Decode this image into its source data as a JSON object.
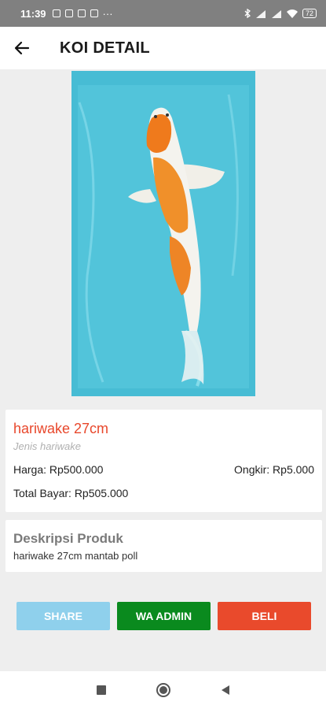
{
  "status_bar": {
    "time": "11:39",
    "more": "···",
    "battery": "72"
  },
  "app_bar": {
    "title": "KOI DETAIL"
  },
  "product": {
    "name": "hariwake 27cm",
    "type": "Jenis hariwake",
    "price": "Harga: Rp500.000",
    "shipping": "Ongkir: Rp5.000",
    "total": "Total Bayar: Rp505.000"
  },
  "description": {
    "title": "Deskripsi Produk",
    "text": "hariwake 27cm mantab poll"
  },
  "buttons": {
    "share": "SHARE",
    "wa_admin": "WA ADMIN",
    "beli": "BELI"
  },
  "colors": {
    "accent_red": "#e8472b",
    "share_blue": "#8fd0ec",
    "wa_green": "#0a8a1e",
    "water": "#4fc0d6"
  },
  "icons": [
    "back-arrow-icon",
    "nav-recents-icon",
    "nav-home-icon",
    "nav-back-icon",
    "wifi-icon",
    "signal-icon",
    "battery-icon"
  ]
}
